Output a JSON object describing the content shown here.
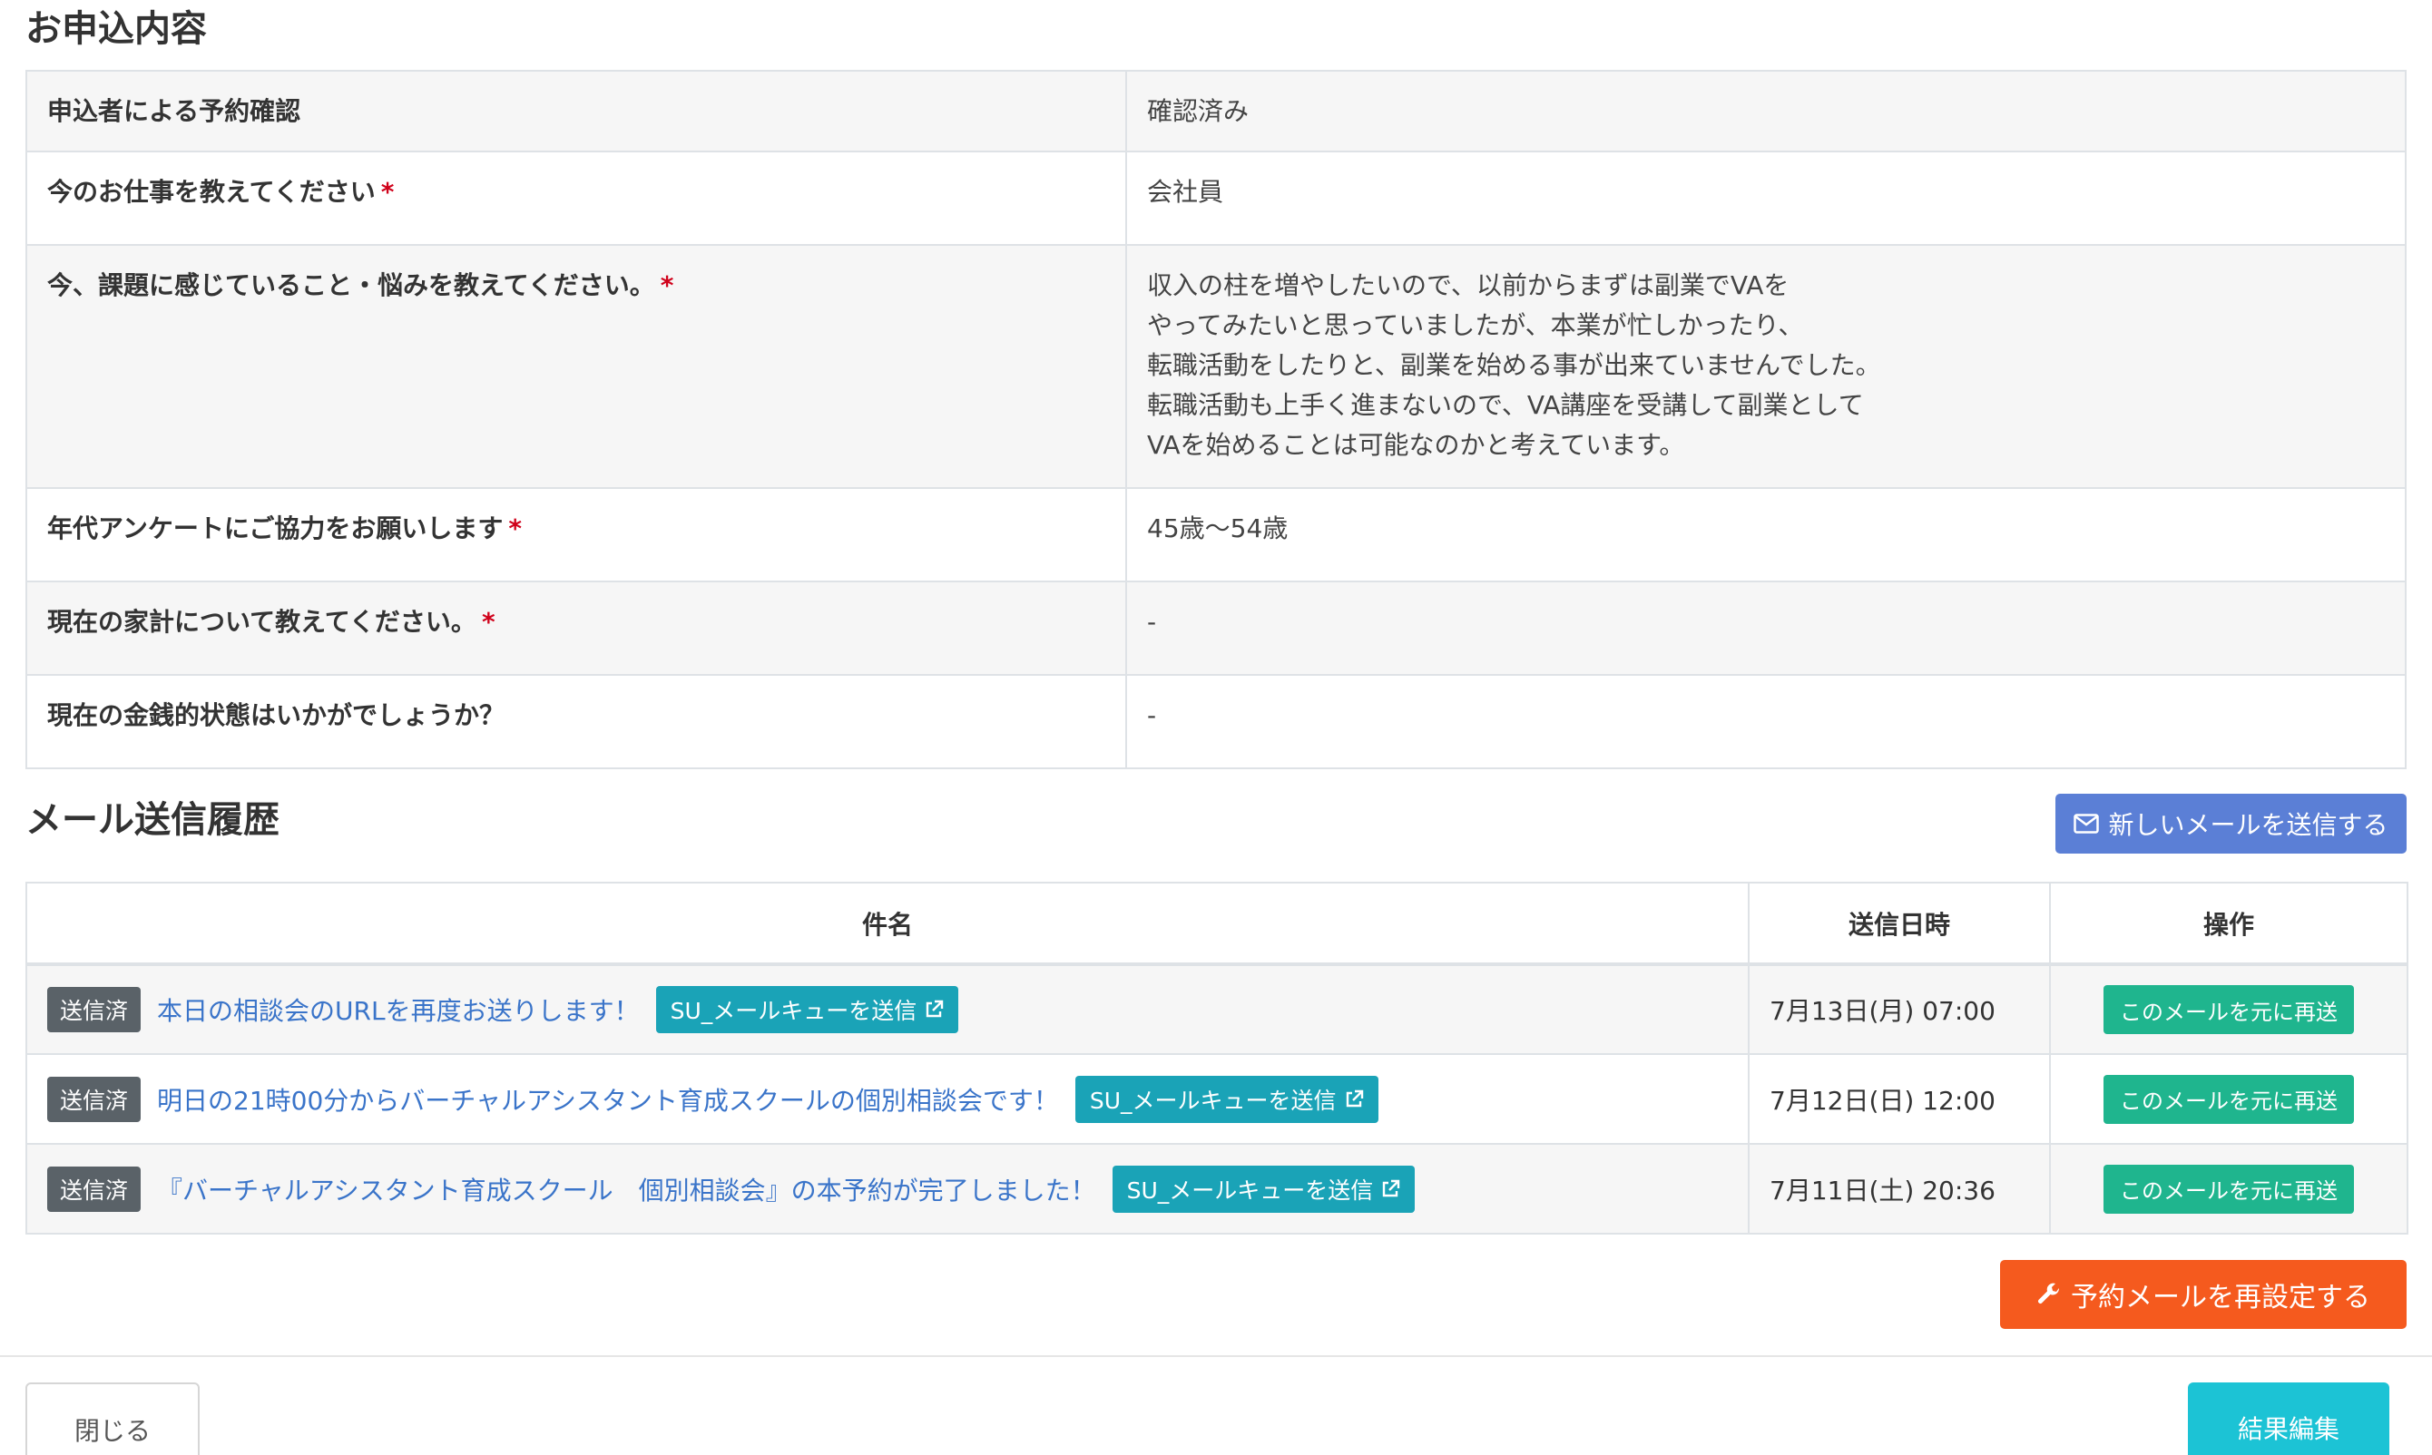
{
  "application": {
    "title": "お申込内容",
    "rows": [
      {
        "question": "申込者による予約確認",
        "required": false,
        "answer_lines": [
          "確認済み"
        ]
      },
      {
        "question": "今のお仕事を教えてください",
        "required": true,
        "answer_lines": [
          "会社員"
        ]
      },
      {
        "question": "今、課題に感じていること・悩みを教えてください。",
        "required": true,
        "answer_lines": [
          "収入の柱を増やしたいので、以前からまずは副業でVAを",
          "やってみたいと思っていましたが、本業が忙しかったり、",
          "転職活動をしたりと、副業を始める事が出来ていませんでした。",
          "転職活動も上手く進まないので、VA講座を受講して副業として",
          "VAを始めることは可能なのかと考えています。"
        ]
      },
      {
        "question": "年代アンケートにご協力をお願いします",
        "required": true,
        "answer_lines": [
          "45歳〜54歳"
        ]
      },
      {
        "question": "現在の家計について教えてください。",
        "required": true,
        "answer_lines": [
          "-"
        ]
      },
      {
        "question": "現在の金銭的状態はいかがでしょうか？",
        "required": false,
        "answer_lines": [
          "-"
        ]
      }
    ],
    "required_mark": "*"
  },
  "mail_history": {
    "title": "メール送信履歴",
    "new_mail_button": "新しいメールを送信する",
    "columns": {
      "subject": "件名",
      "sent_at": "送信日時",
      "actions": "操作"
    },
    "rows": [
      {
        "status": "送信済",
        "subject": "本日の相談会のURLを再度お送りします！",
        "queue_button": "SU_メールキューを送信",
        "sent_at": "7月13日(月) 07:00",
        "resend_button": "このメールを元に再送"
      },
      {
        "status": "送信済",
        "subject": "明日の21時00分からバーチャルアシスタント育成スクールの個別相談会です！",
        "queue_button": "SU_メールキューを送信",
        "sent_at": "7月12日(日) 12:00",
        "resend_button": "このメールを元に再送"
      },
      {
        "status": "送信済",
        "subject": "『バーチャルアシスタント育成スクール　個別相談会』の本予約が完了しました！",
        "queue_button": "SU_メールキューを送信",
        "sent_at": "7月11日(土) 20:36",
        "resend_button": "このメールを元に再送"
      }
    ],
    "reset_button": "予約メールを再設定する"
  },
  "footer": {
    "close_button": "閉じる",
    "edit_button": "結果編集"
  },
  "colors": {
    "new_mail_button": "#5b7fd6",
    "queue_button": "#1aa3b7",
    "resend_button": "#1fb58e",
    "reset_button": "#f55a1e",
    "edit_button": "#1cc3d5",
    "required_mark": "#d0021b",
    "link": "#3a74c9"
  },
  "icons": {
    "new_mail": "envelope-icon",
    "queue": "external-link-icon",
    "reset": "wrench-icon"
  }
}
